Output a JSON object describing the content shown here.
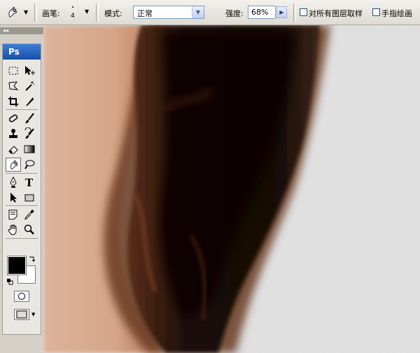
{
  "options_bar": {
    "tool_preset_icon": "smudge-tool-icon",
    "brush_label": "画笔:",
    "brush_size": "4",
    "mode_label": "模式:",
    "mode_value": "正常",
    "strength_label": "强度:",
    "strength_value": "68%",
    "sample_all_layers_label": "对所有图层取样",
    "sample_all_layers_checked": false,
    "finger_painting_label": "手指绘画",
    "finger_painting_checked": false
  },
  "panel": {
    "collapse_icon": "double-chevron-left-icon"
  },
  "toolbox": {
    "logo": "Ps",
    "tools": [
      {
        "name": "marquee-tool-icon"
      },
      {
        "name": "move-tool-icon"
      },
      {
        "name": "lasso-tool-icon"
      },
      {
        "name": "magic-wand-tool-icon"
      },
      {
        "name": "crop-tool-icon"
      },
      {
        "name": "slice-tool-icon"
      },
      {
        "name": "healing-brush-tool-icon"
      },
      {
        "name": "brush-tool-icon"
      },
      {
        "name": "clone-stamp-tool-icon"
      },
      {
        "name": "history-brush-tool-icon"
      },
      {
        "name": "eraser-tool-icon"
      },
      {
        "name": "gradient-tool-icon"
      },
      {
        "name": "smudge-tool-icon",
        "selected": true
      },
      {
        "name": "dodge-tool-icon"
      },
      {
        "name": "pen-tool-icon"
      },
      {
        "name": "type-tool-icon"
      },
      {
        "name": "path-selection-tool-icon"
      },
      {
        "name": "shape-tool-icon"
      },
      {
        "name": "notes-tool-icon"
      },
      {
        "name": "eyedropper-tool-icon"
      },
      {
        "name": "hand-tool-icon"
      },
      {
        "name": "zoom-tool-icon"
      }
    ],
    "type_tool_glyph": "T",
    "foreground_color": "#000000",
    "background_color": "#ffffff"
  },
  "canvas": {
    "content": "zoomed photo: skin on left, dark brown hair strand, light gray background on right",
    "skin_color": "#d9a98e",
    "hair_color": "#1b0e08",
    "hair_highlight_color": "#6b3a22",
    "background_color": "#e6e6e6"
  }
}
